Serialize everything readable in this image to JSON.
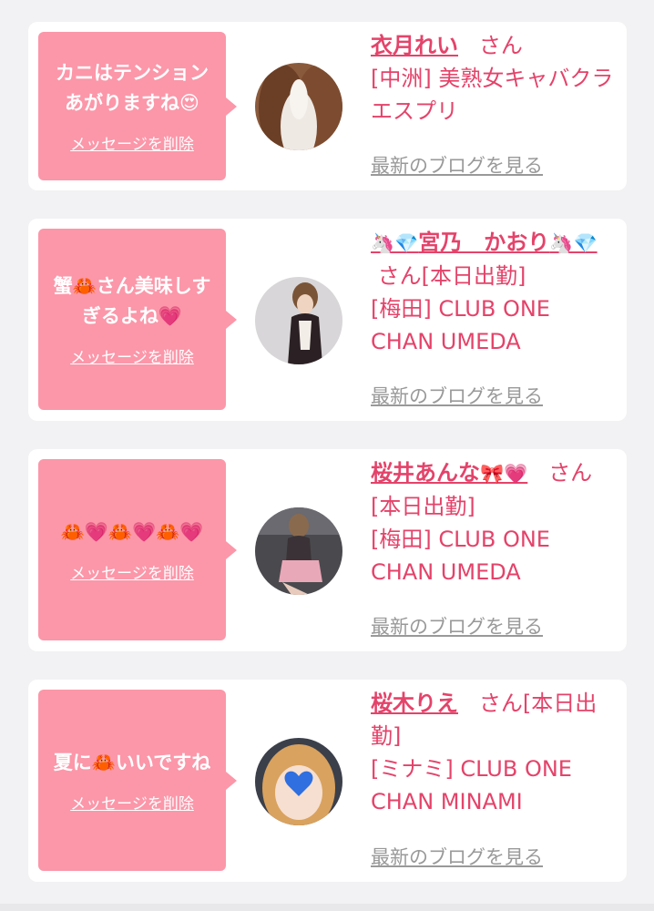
{
  "delete_label": "メッセージを削除",
  "blog_label": "最新のブログを見る",
  "cards": [
    {
      "message_text_1": "カニはテンション",
      "message_text_2": "あがりますね",
      "message_emoji": "😍",
      "name": "衣月れい",
      "honorific": "さん",
      "shop": "[中洲] 美熟女キャバクラ エスプリ"
    },
    {
      "message_emoji_1": "🦀",
      "message_text_1": "蟹",
      "message_text_2": "さん美味しす",
      "message_text_3": "ぎるよね",
      "message_emoji_2": "💗",
      "name_emoji_1": "🦄💎",
      "name": "宮乃　かおり",
      "name_emoji_2": "🦄💎",
      "honorific": "さん[本日出勤]",
      "shop_line_1": "[梅田] CLUB ONE",
      "shop_line_2": "CHAN UMEDA"
    },
    {
      "message_emoji": "🦀💗🦀💗🦀💗",
      "name": "桜井あんな",
      "name_emoji": "🎀💗",
      "honorific": "さん",
      "status": "[本日出勤]",
      "shop_line_1": "[梅田] CLUB ONE",
      "shop_line_2": "CHAN UMEDA"
    },
    {
      "message_text_1": "夏に",
      "message_emoji": "🦀",
      "message_text_2": "いいですね",
      "name": "桜木りえ",
      "honorific": "さん[本日出勤]",
      "shop_line_1": "[ミナミ] CLUB ONE",
      "shop_line_2": "CHAN MINAMI"
    }
  ],
  "colors": {
    "accent": "#e4436a",
    "bubble": "#fb97a9",
    "background": "#f2f2f4",
    "muted": "#999999"
  }
}
